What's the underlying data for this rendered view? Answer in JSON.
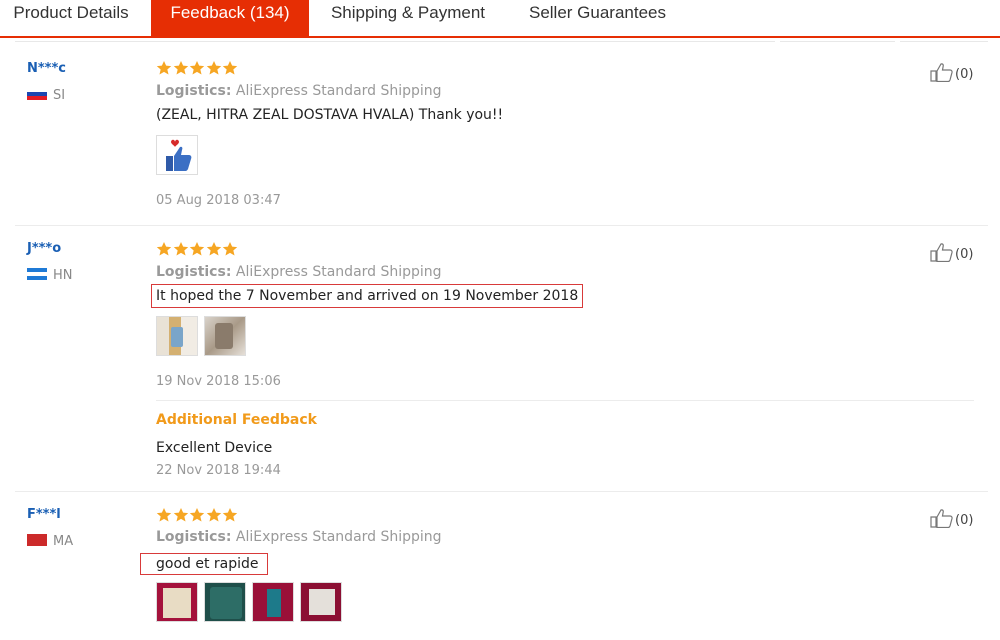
{
  "tabs": [
    {
      "label": "Product Details",
      "active": false
    },
    {
      "label": "Feedback (134)",
      "active": true
    },
    {
      "label": "Shipping & Payment",
      "active": false
    },
    {
      "label": "Seller Guarantees",
      "active": false
    }
  ],
  "colors": {
    "accent": "#e62e04",
    "star": "#f6a623",
    "user": "#1a5fb4",
    "additional": "#f19a1a",
    "highlight_box": "#d83a3a"
  },
  "logistics_label": "Logistics:",
  "reviews": [
    {
      "user": "N***c",
      "country": "SI",
      "rating": 5,
      "logistics": "AliExpress Standard Shipping",
      "text": "(ZEAL, HITRA ZEAL DOSTAVA HVALA) Thank you!!",
      "date": "05 Aug 2018 03:47",
      "likes": "(0)"
    },
    {
      "user": "J***o",
      "country": "HN",
      "rating": 5,
      "logistics": "AliExpress Standard Shipping",
      "text": "It hoped the 7 November and arrived on 19 November 2018",
      "date": "19 Nov 2018 15:06",
      "likes": "(0)",
      "additional": {
        "title": "Additional Feedback",
        "text": "Excellent Device",
        "date": "22 Nov 2018 19:44"
      }
    },
    {
      "user": "F***l",
      "country": "MA",
      "rating": 5,
      "logistics": "AliExpress Standard Shipping",
      "text": "good et rapide",
      "likes": "(0)"
    }
  ]
}
